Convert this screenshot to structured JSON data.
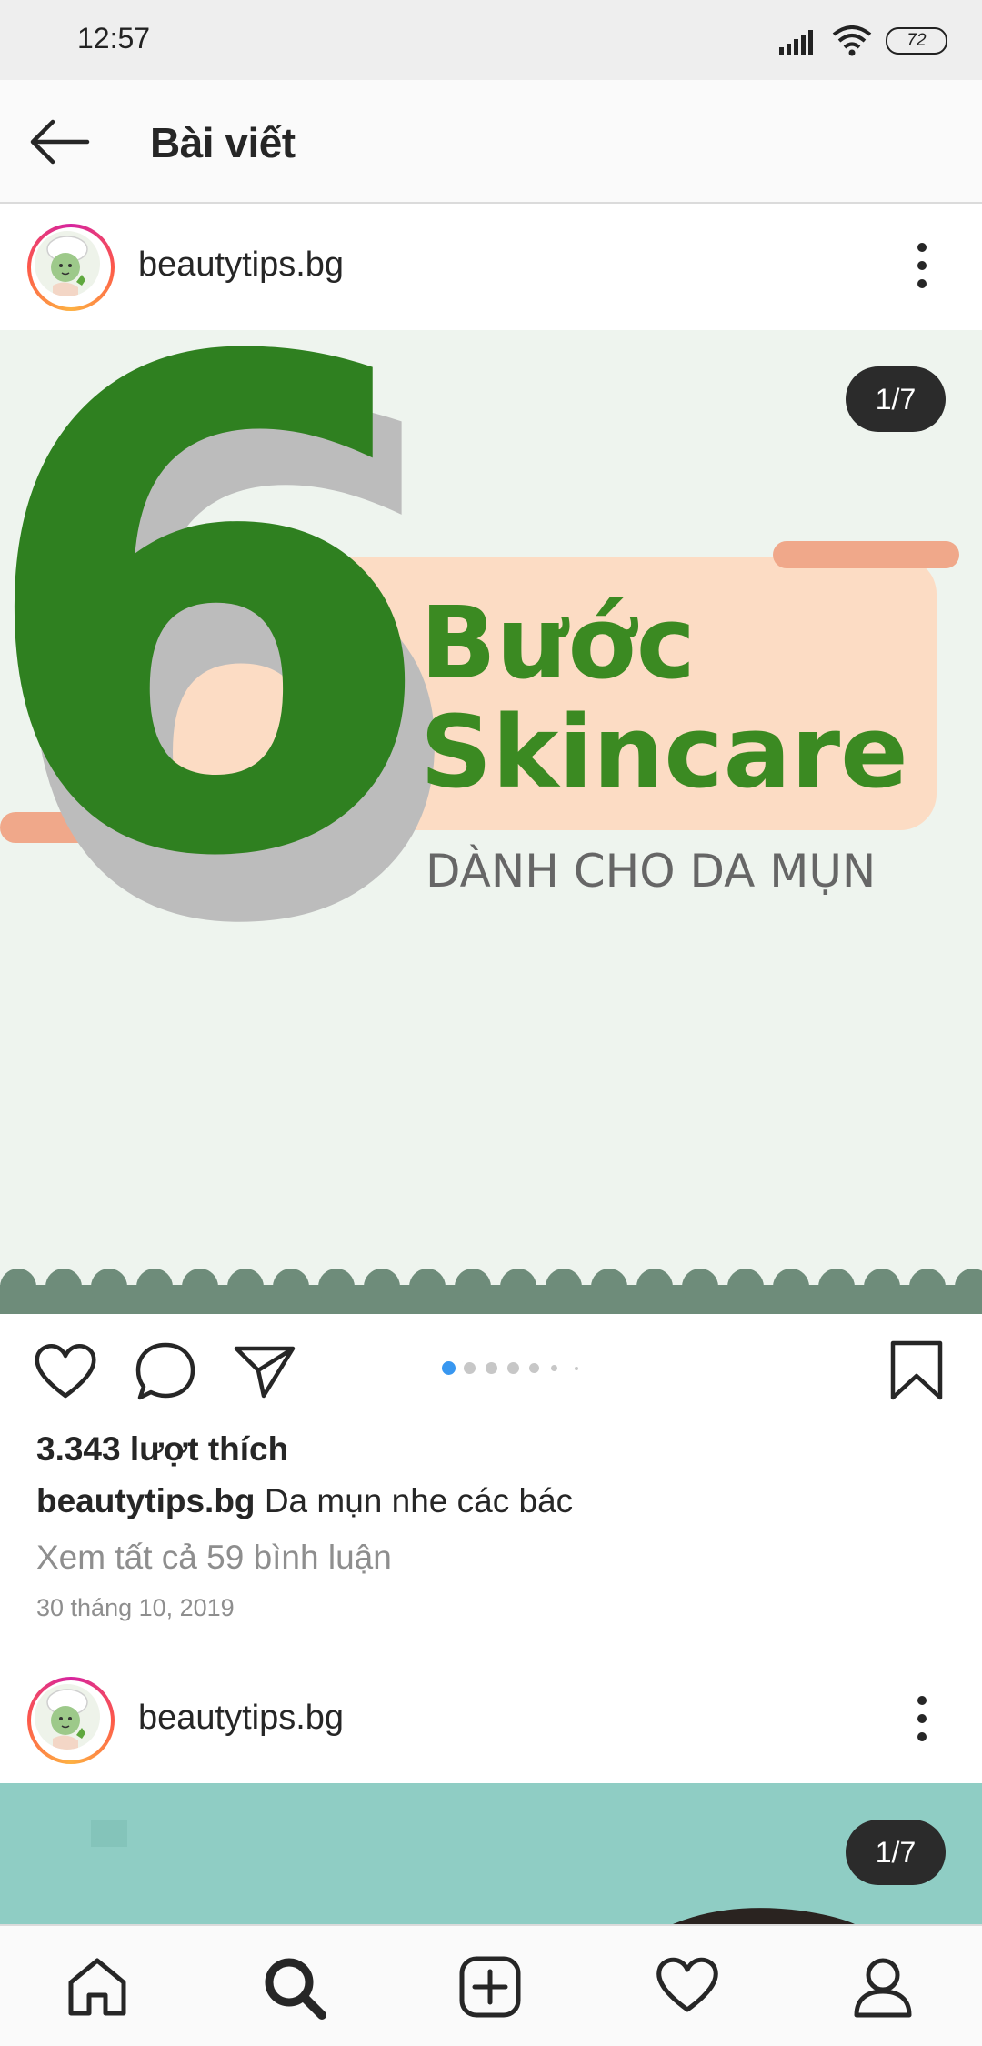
{
  "status": {
    "time": "12:57",
    "battery": "72"
  },
  "header": {
    "title": "Bài viết"
  },
  "post1": {
    "username": "beautytips.bg",
    "counter": "1/7",
    "graphic": {
      "number": "6",
      "line1": "Bước",
      "line2": "Skincare",
      "line3": "DÀNH CHO DA MỤN"
    },
    "likes": "3.343 lượt thích",
    "caption_user": "beautytips.bg",
    "caption_text": "Da mụn nhe các bác",
    "comments_link": "Xem tất cả 59 bình luận",
    "date": "30 tháng 10, 2019"
  },
  "post2": {
    "username": "beautytips.bg",
    "counter": "1/7"
  },
  "colors": {
    "accent_blue": "#3897f0",
    "brand_green": "#2e7d1f",
    "peach": "#fcdcc4"
  }
}
